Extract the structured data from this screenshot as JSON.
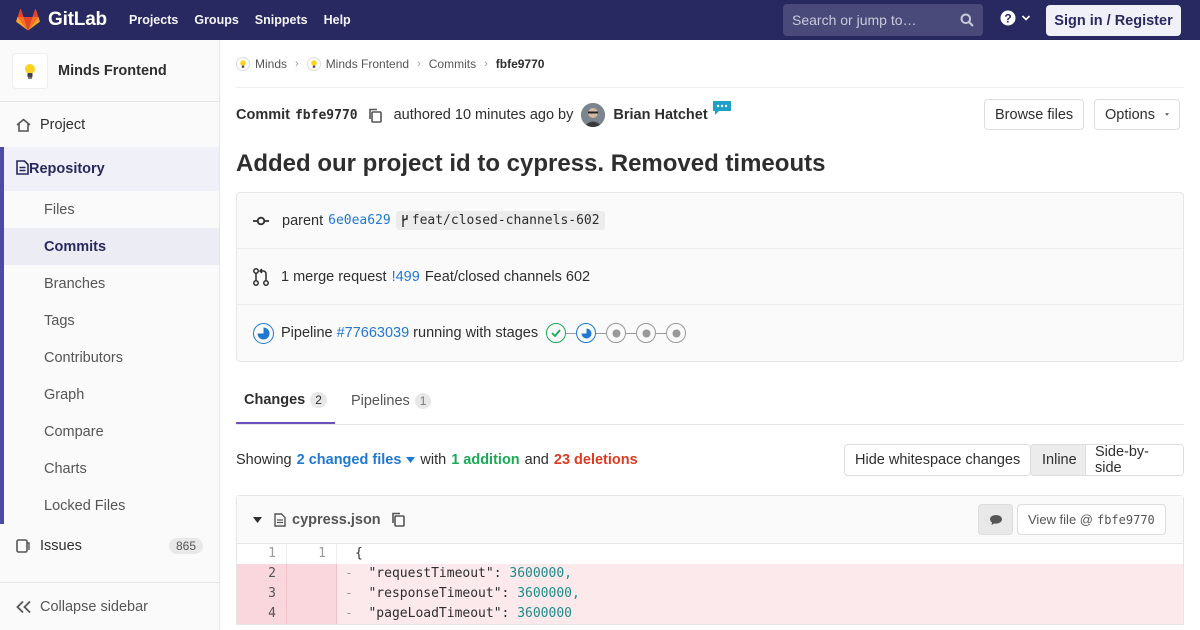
{
  "topbar": {
    "brand": "GitLab",
    "nav": [
      "Projects",
      "Groups",
      "Snippets",
      "Help"
    ],
    "search_placeholder": "Search or jump to…",
    "signin": "Sign in / Register",
    "colors": {
      "bg": "#292961",
      "accent": "#e24329"
    }
  },
  "sidebar": {
    "project_name": "Minds Frontend",
    "project_item": "Project",
    "repository": "Repository",
    "repo_items": [
      "Files",
      "Commits",
      "Branches",
      "Tags",
      "Contributors",
      "Graph",
      "Compare",
      "Charts",
      "Locked Files"
    ],
    "active_item": "Commits",
    "issues_label": "Issues",
    "issues_count": "865",
    "collapse": "Collapse sidebar"
  },
  "breadcrumb": {
    "items": [
      "Minds",
      "Minds Frontend",
      "Commits",
      "fbfe9770"
    ]
  },
  "commit": {
    "label": "Commit",
    "sha": "fbfe9770",
    "authored": "authored 10 minutes ago by",
    "author": "Brian Hatchet",
    "browse_files": "Browse files",
    "options": "Options",
    "title": "Added our project id to cypress. Removed timeouts",
    "parent_label": "parent",
    "parent_sha": "6e0ea629",
    "branch": "feat/closed-channels-602",
    "mr_prefix": "1 merge request",
    "mr_link": "!499",
    "mr_title": "Feat/closed channels 602",
    "pipeline_label": "Pipeline",
    "pipeline_link": "#77663039",
    "pipeline_status": "running with stages"
  },
  "tabs": {
    "changes": "Changes",
    "changes_count": "2",
    "pipelines": "Pipelines",
    "pipelines_count": "1"
  },
  "summary": {
    "showing": "Showing",
    "changed_files": "2 changed files",
    "with": "with",
    "additions": "1 addition",
    "and": "and",
    "deletions": "23 deletions",
    "hide_whitespace": "Hide whitespace changes",
    "inline": "Inline",
    "side_by_side": "Side-by-side"
  },
  "file": {
    "name": "cypress.json",
    "view_file": "View file @",
    "view_sha": "fbfe9770",
    "lines": [
      {
        "old": "1",
        "new": "1",
        "type": "context",
        "sign": "",
        "key": "{",
        "value": ""
      },
      {
        "old": "2",
        "new": "",
        "type": "del",
        "sign": "-",
        "key": "  \"requestTimeout\": ",
        "value": "3600000,"
      },
      {
        "old": "3",
        "new": "",
        "type": "del",
        "sign": "-",
        "key": "  \"responseTimeout\": ",
        "value": "3600000,"
      },
      {
        "old": "4",
        "new": "",
        "type": "del",
        "sign": "-",
        "key": "  \"pageLoadTimeout\": ",
        "value": "3600000"
      }
    ]
  }
}
